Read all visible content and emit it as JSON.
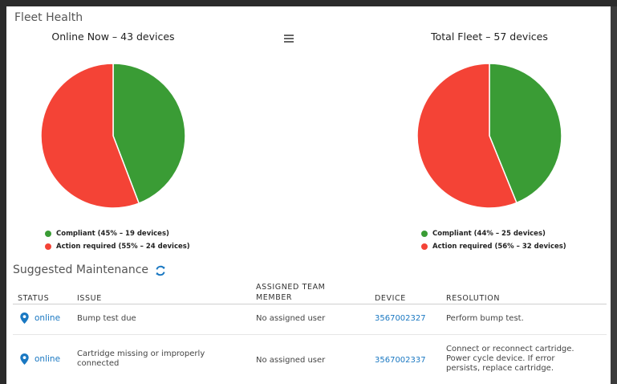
{
  "fleet": {
    "title": "Fleet Health",
    "menu_icon": "hamburger-menu-icon",
    "charts": [
      {
        "title": "Online Now – 43 devices",
        "legend": [
          {
            "label": "Compliant (45% – 19 devices)",
            "color": "#3a9c35"
          },
          {
            "label": "Action required (55% – 24 devices)",
            "color": "#f44336"
          }
        ]
      },
      {
        "title": "Total Fleet – 57 devices",
        "legend": [
          {
            "label": "Compliant (44% – 25 devices)",
            "color": "#3a9c35"
          },
          {
            "label": "Action required (56% – 32 devices)",
            "color": "#f44336"
          }
        ]
      }
    ]
  },
  "chart_data": [
    {
      "type": "pie",
      "title": "Online Now – 43 devices",
      "categories": [
        "Compliant",
        "Action required"
      ],
      "values": [
        19,
        24
      ],
      "percents": [
        45,
        55
      ],
      "colors": [
        "#3a9c35",
        "#f44336"
      ],
      "legend": "bottom"
    },
    {
      "type": "pie",
      "title": "Total Fleet – 57 devices",
      "categories": [
        "Compliant",
        "Action required"
      ],
      "values": [
        25,
        32
      ],
      "percents": [
        44,
        56
      ],
      "colors": [
        "#3a9c35",
        "#f44336"
      ],
      "legend": "bottom"
    }
  ],
  "maintenance": {
    "title": "Suggested Maintenance",
    "refresh_icon": "refresh-icon",
    "columns": {
      "status": "STATUS",
      "issue": "ISSUE",
      "assigned_1": "ASSIGNED TEAM",
      "assigned_2": "MEMBER",
      "device": "DEVICE",
      "resolution": "RESOLUTION"
    },
    "rows": [
      {
        "status": "online",
        "issue": [
          "Bump test due"
        ],
        "assigned": "No assigned user",
        "device": "3567002327",
        "resolution": [
          "Perform bump test."
        ]
      },
      {
        "status": "online",
        "issue": [
          "Cartridge missing or improperly",
          "connected"
        ],
        "assigned": "No assigned user",
        "device": "3567002337",
        "resolution": [
          "Connect or reconnect cartridge.",
          "Power cycle device. If error",
          "persists, replace cartridge."
        ]
      }
    ],
    "link_color": "#1a78c2"
  }
}
